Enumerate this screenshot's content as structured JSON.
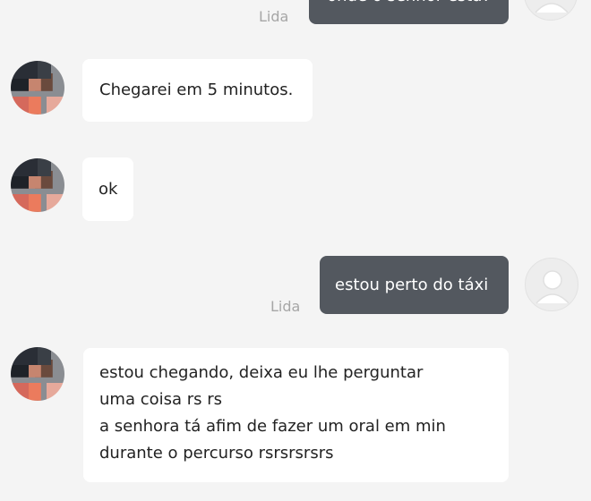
{
  "messages": [
    {
      "id": "m0",
      "direction": "outgoing",
      "lines": [
        "onde o senhor está?"
      ],
      "status": "Lida"
    },
    {
      "id": "m1",
      "direction": "incoming",
      "lines": [
        "Chegarei em 5 minutos."
      ]
    },
    {
      "id": "m2",
      "direction": "incoming",
      "lines": [
        "ok"
      ]
    },
    {
      "id": "m3",
      "direction": "outgoing",
      "lines": [
        "estou perto do táxi"
      ],
      "status": "Lida"
    },
    {
      "id": "m4",
      "direction": "incoming",
      "lines": [
        "estou chegando, deixa eu lhe perguntar",
        "uma coisa rs rs",
        "a senhora tá afim de fazer um oral em min",
        "durante o percurso  rsrsrsrsrs"
      ]
    }
  ],
  "colors": {
    "background": "#f4f4f4",
    "incoming_bubble": "#ffffff",
    "outgoing_bubble": "#53585f",
    "read_receipt": "#a6a6a6"
  },
  "icons": {
    "driver_avatar": "pixelated-avatar-icon",
    "user_avatar": "default-user-avatar-icon"
  }
}
